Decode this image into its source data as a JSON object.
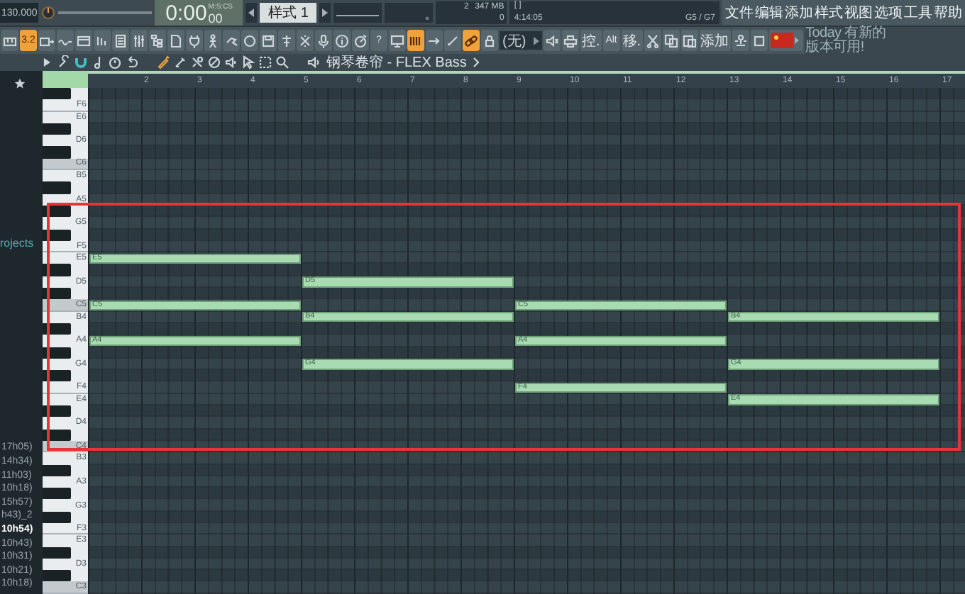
{
  "transport": {
    "tempo": "130.000",
    "time": "0:00",
    "time_fraction": "00",
    "time_unit": "M:S:CS",
    "pattern": "样式 1",
    "cpu": "2",
    "memory": "347 MB",
    "polyphony": "0",
    "hint_brackets": "[   ]",
    "position": "4:14:05",
    "note_info": "G5 / G7"
  },
  "menu": [
    "文件",
    "编辑",
    "添加",
    "样式",
    "视图",
    "选项",
    "工具",
    "帮助"
  ],
  "toolbar": [
    {
      "kind": "icon",
      "on": false
    },
    {
      "kind": "text",
      "label": "3.2",
      "on": true
    },
    {
      "kind": "icon",
      "on": false
    },
    {
      "kind": "icon",
      "on": false
    },
    {
      "kind": "icon",
      "on": false
    },
    {
      "kind": "icon",
      "on": false
    },
    {
      "kind": "icon",
      "on": false
    },
    {
      "kind": "icon",
      "on": false
    },
    {
      "kind": "icon",
      "on": false
    },
    {
      "kind": "icon",
      "on": false
    },
    {
      "kind": "icon",
      "on": false
    },
    {
      "kind": "icon",
      "on": false
    },
    {
      "kind": "icon",
      "on": false
    },
    {
      "kind": "icon",
      "on": false
    },
    {
      "kind": "icon",
      "on": false
    },
    {
      "kind": "icon",
      "on": false
    },
    {
      "kind": "icon",
      "on": false
    },
    {
      "kind": "icon",
      "on": false
    },
    {
      "kind": "icon",
      "on": false
    },
    {
      "kind": "icon",
      "on": false
    },
    {
      "kind": "text",
      "label": "?",
      "on": false
    },
    {
      "kind": "icon",
      "on": false
    },
    {
      "kind": "icon",
      "on": true
    },
    {
      "kind": "icon",
      "on": false
    },
    {
      "kind": "icon",
      "on": false
    },
    {
      "kind": "icon",
      "on": true
    },
    {
      "kind": "icon",
      "on": false
    },
    {
      "kind": "dropdown",
      "label": "(无)"
    },
    {
      "kind": "icon",
      "on": false
    },
    {
      "kind": "icon",
      "on": false
    },
    {
      "kind": "text",
      "label": "控.",
      "on": false
    },
    {
      "kind": "text",
      "label": "Alt",
      "on": false
    },
    {
      "kind": "text",
      "label": "移.",
      "on": false
    },
    {
      "kind": "icon",
      "on": false
    },
    {
      "kind": "icon",
      "on": false
    },
    {
      "kind": "icon",
      "on": false
    },
    {
      "kind": "text",
      "label": "添加",
      "on": false
    },
    {
      "kind": "icon",
      "on": false
    },
    {
      "kind": "icon",
      "on": false
    },
    {
      "kind": "icon",
      "on": false
    }
  ],
  "hint": [
    "Today 有新的",
    "版本可用!"
  ],
  "piano_roll_toolbar": {
    "tools": [
      {
        "on": false
      },
      {
        "on": false
      },
      {
        "on": true
      },
      {
        "on": false
      },
      {
        "on": false
      },
      {
        "on": false
      },
      {
        "on": true
      },
      {
        "on": false
      },
      {
        "on": false
      },
      {
        "on": false
      },
      {
        "on": false
      },
      {
        "on": false
      },
      {
        "on": false
      },
      {
        "on": false
      },
      {
        "on": false
      }
    ],
    "title": "钢琴卷帘 - FLEX Bass"
  },
  "browser": {
    "label": "rojects",
    "items": [
      {
        "text": "17h05)",
        "selected": false
      },
      {
        "text": "14h34)",
        "selected": false
      },
      {
        "text": "11h03)",
        "selected": false
      },
      {
        "text": "10h18)",
        "selected": false
      },
      {
        "text": "15h57)",
        "selected": false
      },
      {
        "text": "h43)_2",
        "selected": false
      },
      {
        "text": "10h54)",
        "selected": true
      },
      {
        "text": "10h43)",
        "selected": false
      },
      {
        "text": "10h31)",
        "selected": false
      },
      {
        "text": "10h21)",
        "selected": false
      },
      {
        "text": "10h18)",
        "selected": false
      }
    ]
  },
  "keyboard": {
    "white_keys": [
      "F6",
      "E6",
      "D6",
      "C6",
      "B5",
      "A5",
      "G5",
      "F5",
      "E5",
      "D5",
      "C5",
      "B4",
      "A4",
      "G4",
      "F4",
      "E4",
      "D4",
      "C4",
      "B3",
      "A3",
      "G3",
      "F3",
      "E3",
      "D3",
      "C3"
    ]
  },
  "ruler": [
    "2",
    "3",
    "4",
    "5",
    "6",
    "7",
    "8",
    "9",
    "10",
    "11",
    "12",
    "13",
    "14",
    "15",
    "16",
    "17"
  ],
  "chords": [
    {
      "notes": [
        "E5",
        "C5",
        "A4"
      ]
    },
    {
      "notes": [
        "D5",
        "B4",
        "G4"
      ]
    },
    {
      "notes": [
        "C5",
        "A4",
        "F4"
      ]
    },
    {
      "notes": [
        "B4",
        "G4",
        "E4"
      ]
    }
  ]
}
